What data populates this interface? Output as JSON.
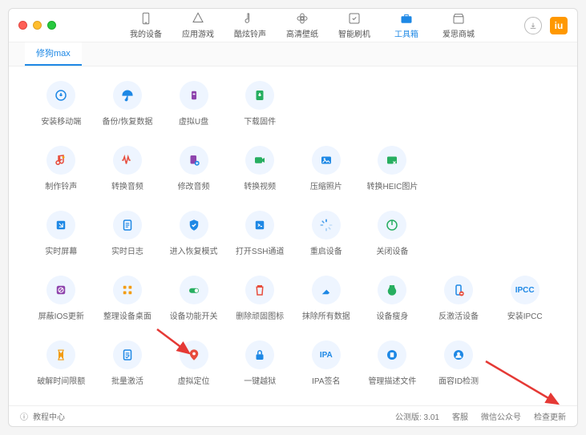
{
  "topnav": [
    {
      "label": "我的设备",
      "name": "nav-device"
    },
    {
      "label": "应用游戏",
      "name": "nav-apps"
    },
    {
      "label": "酷炫铃声",
      "name": "nav-ringtones"
    },
    {
      "label": "高清壁纸",
      "name": "nav-wallpapers"
    },
    {
      "label": "智能刷机",
      "name": "nav-flash"
    },
    {
      "label": "工具箱",
      "name": "nav-toolbox",
      "active": true
    },
    {
      "label": "爱思商城",
      "name": "nav-store"
    }
  ],
  "tab": {
    "label": "修狗max"
  },
  "tools": [
    {
      "label": "安装移动端",
      "name": "install-mobile",
      "icon": "install",
      "c": "#1e88e5"
    },
    {
      "label": "备份/恢复数据",
      "name": "backup-restore",
      "icon": "umbrella",
      "c": "#1e88e5"
    },
    {
      "label": "虚拟U盘",
      "name": "virtual-usb",
      "icon": "usb",
      "c": "#8e44ad"
    },
    {
      "label": "下载固件",
      "name": "download-firmware",
      "icon": "download",
      "c": "#27ae60"
    },
    {
      "label": "",
      "name": "",
      "icon": "",
      "c": ""
    },
    {
      "label": "",
      "name": "",
      "icon": "",
      "c": ""
    },
    {
      "label": "",
      "name": "",
      "icon": "",
      "c": ""
    },
    {
      "label": "",
      "name": "",
      "icon": "",
      "c": ""
    },
    {
      "label": "制作铃声",
      "name": "make-ringtone",
      "icon": "music",
      "c": "#e74c3c"
    },
    {
      "label": "转换音频",
      "name": "convert-audio",
      "icon": "wave",
      "c": "#e74c3c"
    },
    {
      "label": "修改音频",
      "name": "edit-audio",
      "icon": "audioedit",
      "c": "#8e44ad"
    },
    {
      "label": "转换视频",
      "name": "convert-video",
      "icon": "video",
      "c": "#27ae60"
    },
    {
      "label": "压缩照片",
      "name": "compress-photo",
      "icon": "photo",
      "c": "#1e88e5"
    },
    {
      "label": "转换HEIC图片",
      "name": "convert-heic",
      "icon": "heic",
      "c": "#27ae60"
    },
    {
      "label": "",
      "name": "",
      "icon": "",
      "c": ""
    },
    {
      "label": "",
      "name": "",
      "icon": "",
      "c": ""
    },
    {
      "label": "实时屏幕",
      "name": "realtime-screen",
      "icon": "screen",
      "c": "#1e88e5"
    },
    {
      "label": "实时日志",
      "name": "realtime-log",
      "icon": "log",
      "c": "#1e88e5"
    },
    {
      "label": "进入恢复模式",
      "name": "recovery-mode",
      "icon": "shield",
      "c": "#1e88e5"
    },
    {
      "label": "打开SSH通道",
      "name": "open-ssh",
      "icon": "ssh",
      "c": "#1e88e5"
    },
    {
      "label": "重启设备",
      "name": "restart-device",
      "icon": "loading",
      "c": "#1e88e5"
    },
    {
      "label": "关闭设备",
      "name": "shutdown-device",
      "icon": "power",
      "c": "#27ae60"
    },
    {
      "label": "",
      "name": "",
      "icon": "",
      "c": ""
    },
    {
      "label": "",
      "name": "",
      "icon": "",
      "c": ""
    },
    {
      "label": "屏蔽IOS更新",
      "name": "block-ios-update",
      "icon": "block",
      "c": "#8e44ad"
    },
    {
      "label": "整理设备桌面",
      "name": "organize-desktop",
      "icon": "grid",
      "c": "#f39c12"
    },
    {
      "label": "设备功能开关",
      "name": "device-switches",
      "icon": "switch",
      "c": "#27ae60"
    },
    {
      "label": "删除顽固图标",
      "name": "delete-stubborn",
      "icon": "trash",
      "c": "#e74c3c"
    },
    {
      "label": "抹除所有数据",
      "name": "erase-all",
      "icon": "erase",
      "c": "#1e88e5"
    },
    {
      "label": "设备瘦身",
      "name": "device-slim",
      "icon": "slim",
      "c": "#27ae60"
    },
    {
      "label": "反激活设备",
      "name": "deactivate",
      "icon": "deact",
      "c": "#1e88e5"
    },
    {
      "label": "安装IPCC",
      "name": "install-ipcc",
      "icon": "ipcc",
      "c": "#1e88e5",
      "txt": "IPCC"
    },
    {
      "label": "破解时间限额",
      "name": "crack-timelimit",
      "icon": "hourglass",
      "c": "#f39c12"
    },
    {
      "label": "批量激活",
      "name": "batch-activate",
      "icon": "batch",
      "c": "#1e88e5"
    },
    {
      "label": "虚拟定位",
      "name": "virtual-location",
      "icon": "location",
      "c": "#e74c3c"
    },
    {
      "label": "一键越狱",
      "name": "jailbreak",
      "icon": "lock",
      "c": "#1e88e5"
    },
    {
      "label": "IPA签名",
      "name": "ipa-sign",
      "icon": "ipa",
      "c": "#1e88e5",
      "txt": "IPA"
    },
    {
      "label": "管理描述文件",
      "name": "manage-profiles",
      "icon": "profile",
      "c": "#1e88e5"
    },
    {
      "label": "面容ID检测",
      "name": "faceid-check",
      "icon": "face",
      "c": "#1e88e5"
    },
    {
      "label": "",
      "name": "",
      "icon": "",
      "c": ""
    }
  ],
  "status": {
    "tutorial": "教程中心",
    "version": "公测版: 3.01",
    "service": "客服",
    "wechat": "微信公众号",
    "update": "检查更新"
  }
}
